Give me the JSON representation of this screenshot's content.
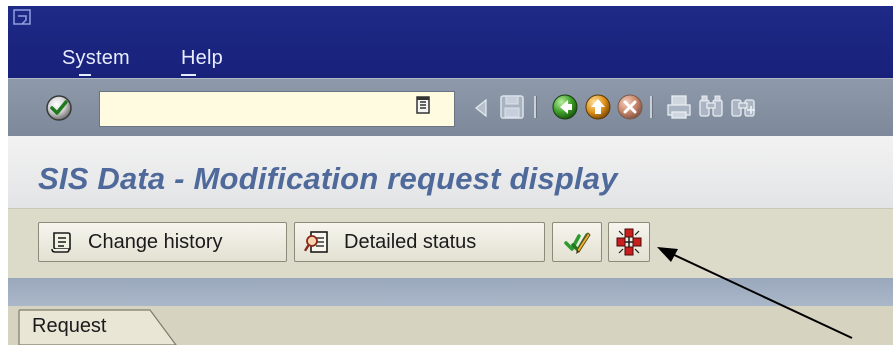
{
  "menu": {
    "system_label": "System",
    "help_label": "Help",
    "system_accel": "y",
    "help_accel": "H"
  },
  "toolbar": {
    "command_field_value": "",
    "icons": [
      "enter-icon",
      "command-dropdown-icon",
      "back-triangle-icon",
      "save-icon",
      "back-icon",
      "exit-icon",
      "cancel-icon",
      "print-icon",
      "find-icon",
      "find-next-icon"
    ]
  },
  "title": {
    "text": "SIS Data - Modification request display",
    "color": "#4f6a9a"
  },
  "app_toolbar": {
    "change_history_label": "Change history",
    "detailed_status_label": "Detailed status",
    "icons": [
      "scroll-icon",
      "magnifier-document-icon",
      "check-pencil-icon",
      "hierarchy-icon"
    ]
  },
  "tabs": [
    {
      "label": "Request",
      "active": true
    }
  ],
  "colors": {
    "menubar": "#1e2a87",
    "toolbar": "#8492a3",
    "background": "#d6d3c1"
  }
}
